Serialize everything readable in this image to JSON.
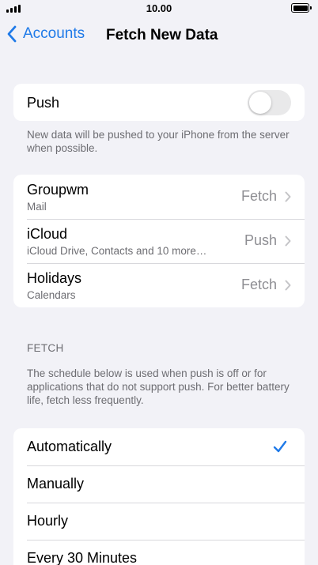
{
  "status_bar": {
    "time": "10.00"
  },
  "nav": {
    "back_label": "Accounts",
    "title": "Fetch New Data"
  },
  "push": {
    "label": "Push",
    "toggle_on": false,
    "footnote": "New data will be pushed to your iPhone from the server when possible."
  },
  "accounts": [
    {
      "name": "Groupwm",
      "subtitle": "Mail",
      "value": "Fetch"
    },
    {
      "name": "iCloud",
      "subtitle": "iCloud Drive, Contacts and 10 more…",
      "value": "Push"
    },
    {
      "name": "Holidays",
      "subtitle": "Calendars",
      "value": "Fetch"
    }
  ],
  "fetch": {
    "header": "FETCH",
    "footnote": "The schedule below is used when push is off or for applications that do not support push. For better battery life, fetch less frequently.",
    "options": [
      "Automatically",
      "Manually",
      "Hourly",
      "Every 30 Minutes"
    ],
    "selected": "Automatically"
  },
  "colors": {
    "accent": "#1f7ae8",
    "background": "#f2f2f7",
    "secondary_text": "#6d6d72"
  }
}
